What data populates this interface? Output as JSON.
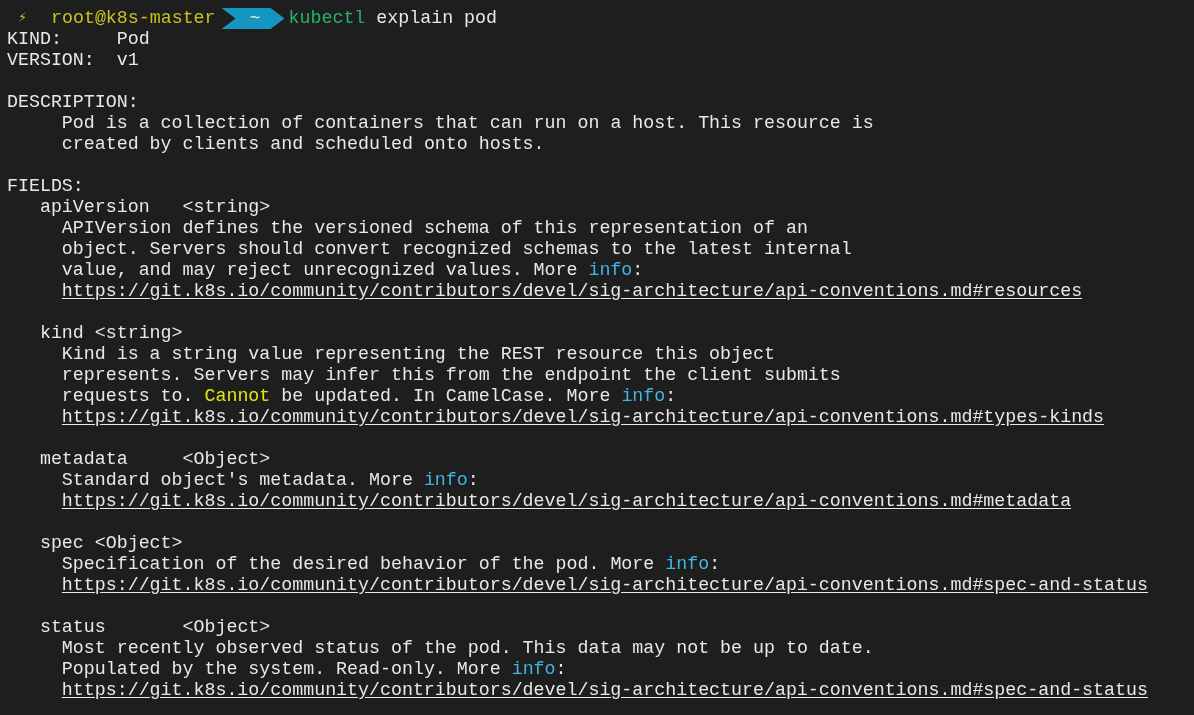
{
  "prompt": {
    "symbol": "⚡",
    "user": "root@k8s-master",
    "directory": "~",
    "command": "kubectl",
    "arguments": "explain pod"
  },
  "lines": [
    {
      "kind": "text",
      "segments": [
        {
          "kind": "plain",
          "text": "KIND:     Pod"
        }
      ]
    },
    {
      "kind": "text",
      "segments": [
        {
          "kind": "plain",
          "text": "VERSION:  v1"
        }
      ]
    },
    {
      "kind": "blank"
    },
    {
      "kind": "text",
      "segments": [
        {
          "kind": "plain",
          "text": "DESCRIPTION:"
        }
      ]
    },
    {
      "kind": "text",
      "segments": [
        {
          "kind": "plain",
          "text": "     Pod is a collection of containers that can run on a host. This resource is"
        }
      ]
    },
    {
      "kind": "text",
      "segments": [
        {
          "kind": "plain",
          "text": "     created by clients and scheduled onto hosts."
        }
      ]
    },
    {
      "kind": "blank"
    },
    {
      "kind": "text",
      "segments": [
        {
          "kind": "plain",
          "text": "FIELDS:"
        }
      ]
    },
    {
      "kind": "text",
      "segments": [
        {
          "kind": "plain",
          "text": "   apiVersion   <string>"
        }
      ]
    },
    {
      "kind": "text",
      "segments": [
        {
          "kind": "plain",
          "text": "     APIVersion defines the versioned schema of this representation of an"
        }
      ]
    },
    {
      "kind": "text",
      "segments": [
        {
          "kind": "plain",
          "text": "     object. Servers should convert recognized schemas to the latest internal"
        }
      ]
    },
    {
      "kind": "text",
      "segments": [
        {
          "kind": "plain",
          "text": "     value, and may reject unrecognized values. More "
        },
        {
          "kind": "info",
          "text": "info"
        },
        {
          "kind": "plain",
          "text": ":"
        }
      ]
    },
    {
      "kind": "link",
      "text": "https://git.k8s.io/community/contributors/devel/sig-architecture/api-conventions.md#resources"
    },
    {
      "kind": "blank"
    },
    {
      "kind": "text",
      "segments": [
        {
          "kind": "plain",
          "text": "   kind <string>"
        }
      ]
    },
    {
      "kind": "text",
      "segments": [
        {
          "kind": "plain",
          "text": "     Kind is a string value representing the REST resource this object"
        }
      ]
    },
    {
      "kind": "text",
      "segments": [
        {
          "kind": "plain",
          "text": "     represents. Servers may infer this from the endpoint the client submits"
        }
      ]
    },
    {
      "kind": "text",
      "segments": [
        {
          "kind": "plain",
          "text": "     requests to. "
        },
        {
          "kind": "caution",
          "text": "Cannot"
        },
        {
          "kind": "plain",
          "text": " be updated. In CamelCase. More "
        },
        {
          "kind": "info",
          "text": "info"
        },
        {
          "kind": "plain",
          "text": ":"
        }
      ]
    },
    {
      "kind": "link",
      "text": "https://git.k8s.io/community/contributors/devel/sig-architecture/api-conventions.md#types-kinds"
    },
    {
      "kind": "blank"
    },
    {
      "kind": "text",
      "segments": [
        {
          "kind": "plain",
          "text": "   metadata     <Object>"
        }
      ]
    },
    {
      "kind": "text",
      "segments": [
        {
          "kind": "plain",
          "text": "     Standard object's metadata. More "
        },
        {
          "kind": "info",
          "text": "info"
        },
        {
          "kind": "plain",
          "text": ":"
        }
      ]
    },
    {
      "kind": "link",
      "text": "https://git.k8s.io/community/contributors/devel/sig-architecture/api-conventions.md#metadata"
    },
    {
      "kind": "blank"
    },
    {
      "kind": "text",
      "segments": [
        {
          "kind": "plain",
          "text": "   spec <Object>"
        }
      ]
    },
    {
      "kind": "text",
      "segments": [
        {
          "kind": "plain",
          "text": "     Specification of the desired behavior of the pod. More "
        },
        {
          "kind": "info",
          "text": "info"
        },
        {
          "kind": "plain",
          "text": ":"
        }
      ]
    },
    {
      "kind": "link",
      "text": "https://git.k8s.io/community/contributors/devel/sig-architecture/api-conventions.md#spec-and-status"
    },
    {
      "kind": "blank"
    },
    {
      "kind": "text",
      "segments": [
        {
          "kind": "plain",
          "text": "   status       <Object>"
        }
      ]
    },
    {
      "kind": "text",
      "segments": [
        {
          "kind": "plain",
          "text": "     Most recently observed status of the pod. This data may not be up to date."
        }
      ]
    },
    {
      "kind": "text",
      "segments": [
        {
          "kind": "plain",
          "text": "     Populated by the system. Read-only. More "
        },
        {
          "kind": "info",
          "text": "info"
        },
        {
          "kind": "plain",
          "text": ":"
        }
      ]
    },
    {
      "kind": "link",
      "text": "https://git.k8s.io/community/contributors/devel/sig-architecture/api-conventions.md#spec-and-status"
    }
  ]
}
